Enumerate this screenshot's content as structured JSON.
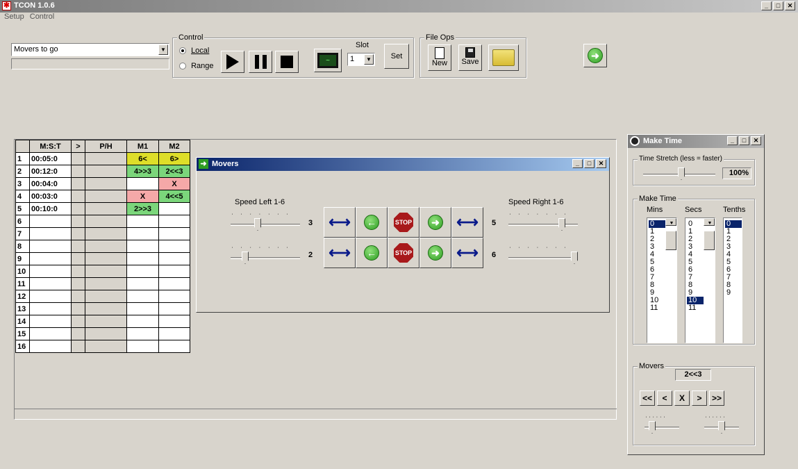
{
  "app": {
    "title": "TCON 1.0.6",
    "icon": "app-star-icon"
  },
  "menu": [
    "Setup",
    "Control"
  ],
  "toolbar": {
    "script_select": "Movers to go",
    "control_group": "Control",
    "radio_local": "Local",
    "radio_range": "Range",
    "slot_label": "Slot",
    "slot_value": "1",
    "set_label": "Set",
    "fileops_group": "File Ops",
    "new_label": "New",
    "save_label": "Save"
  },
  "grid": {
    "headers": [
      "",
      "M:S:T",
      ">",
      "P/H",
      "M1",
      "M2"
    ],
    "rows": [
      {
        "n": "1",
        "t": "00:05:0",
        "m1": "6<",
        "m1c": "yel",
        "m2": "6>",
        "m2c": "yel"
      },
      {
        "n": "2",
        "t": "00:12:0",
        "m1": "4>>3",
        "m1c": "grn",
        "m2": "2<<3",
        "m2c": "grn"
      },
      {
        "n": "3",
        "t": "00:04:0",
        "m1": "",
        "m1c": "",
        "m2": "X",
        "m2c": "red"
      },
      {
        "n": "4",
        "t": "00:03:0",
        "m1": "X",
        "m1c": "red",
        "m2": "4<<5",
        "m2c": "grn"
      },
      {
        "n": "5",
        "t": "00:10:0",
        "m1": "2>>3",
        "m1c": "grn",
        "m2": "",
        "m2c": ""
      },
      {
        "n": "6",
        "t": "",
        "m1": "",
        "m1c": "",
        "m2": "",
        "m2c": ""
      },
      {
        "n": "7",
        "t": "",
        "m1": "",
        "m1c": "",
        "m2": "",
        "m2c": ""
      },
      {
        "n": "8",
        "t": "",
        "m1": "",
        "m1c": "",
        "m2": "",
        "m2c": ""
      },
      {
        "n": "9",
        "t": "",
        "m1": "",
        "m1c": "",
        "m2": "",
        "m2c": ""
      },
      {
        "n": "10",
        "t": "",
        "m1": "",
        "m1c": "",
        "m2": "",
        "m2c": ""
      },
      {
        "n": "11",
        "t": "",
        "m1": "",
        "m1c": "",
        "m2": "",
        "m2c": ""
      },
      {
        "n": "12",
        "t": "",
        "m1": "",
        "m1c": "",
        "m2": "",
        "m2c": ""
      },
      {
        "n": "13",
        "t": "",
        "m1": "",
        "m1c": "",
        "m2": "",
        "m2c": ""
      },
      {
        "n": "14",
        "t": "",
        "m1": "",
        "m1c": "",
        "m2": "",
        "m2c": ""
      },
      {
        "n": "15",
        "t": "",
        "m1": "",
        "m1c": "",
        "m2": "",
        "m2c": ""
      },
      {
        "n": "16",
        "t": "",
        "m1": "",
        "m1c": "",
        "m2": "",
        "m2c": ""
      }
    ]
  },
  "movers_window": {
    "title": "Movers",
    "speed_left_label": "Speed Left 1-6",
    "speed_right_label": "Speed Right 1-6",
    "left1_value": "3",
    "left2_value": "2",
    "right1_value": "5",
    "right2_value": "6",
    "stop_text": "STOP"
  },
  "make_time": {
    "title": "Make Time",
    "stretch_group": "Time Stretch (less = faster)",
    "stretch_value": "100%",
    "make_time_group": "Make Time",
    "mins_label": "Mins",
    "secs_label": "Secs",
    "tenths_label": "Tenths",
    "mins": [
      "0",
      "1",
      "2",
      "3",
      "4",
      "5",
      "6",
      "7",
      "8",
      "9",
      "10",
      "11"
    ],
    "mins_selected": "0",
    "secs": [
      "0",
      "1",
      "2",
      "3",
      "4",
      "5",
      "6",
      "7",
      "8",
      "9",
      "10",
      "11"
    ],
    "secs_selected": "10",
    "tenths": [
      "0",
      "1",
      "2",
      "3",
      "4",
      "5",
      "6",
      "7",
      "8",
      "9"
    ],
    "tenths_selected": "0",
    "movers_group": "Movers",
    "movers_value": "2<<3",
    "nav": [
      "<<",
      "<",
      "X",
      ">",
      ">>"
    ]
  }
}
